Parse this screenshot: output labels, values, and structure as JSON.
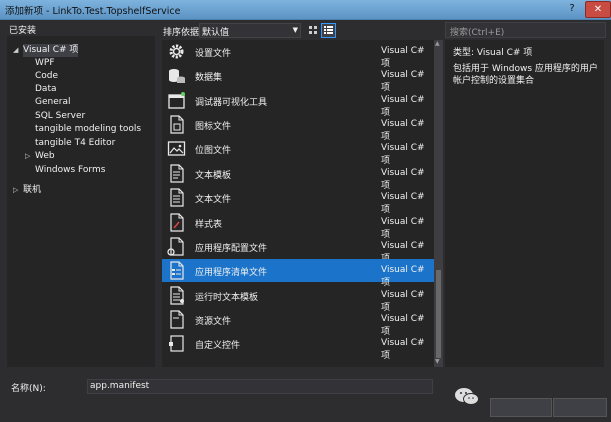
{
  "window": {
    "title": "添加新项 - LinkTo.Test.TopshelfService",
    "help_label": "?",
    "close_label": "✕"
  },
  "left": {
    "installed_label": "已安装",
    "tree": [
      {
        "label": "Visual C# 项",
        "caret": "◢"
      },
      {
        "label": "WPF"
      },
      {
        "label": "Code"
      },
      {
        "label": "Data"
      },
      {
        "label": "General"
      },
      {
        "label": "SQL Server"
      },
      {
        "label": "tangible modeling tools"
      },
      {
        "label": "tangible T4 Editor"
      },
      {
        "label": "Web",
        "caret": "▷"
      },
      {
        "label": "Windows Forms"
      },
      {
        "label": "联机",
        "caret": "▷"
      }
    ]
  },
  "toolbar": {
    "sort_label": "排序依据:",
    "sort_value": "默认值"
  },
  "search": {
    "placeholder": "搜索(Ctrl+E)"
  },
  "items": [
    {
      "name": "设置文件",
      "type": "Visual C# 项",
      "icon": "settings-icon"
    },
    {
      "name": "数据集",
      "type": "Visual C# 项",
      "icon": "dataset-icon"
    },
    {
      "name": "调试器可视化工具",
      "type": "Visual C# 项",
      "icon": "debugger-visualizer-icon"
    },
    {
      "name": "图标文件",
      "type": "Visual C# 项",
      "icon": "icon-file-icon"
    },
    {
      "name": "位图文件",
      "type": "Visual C# 项",
      "icon": "bitmap-icon"
    },
    {
      "name": "文本模板",
      "type": "Visual C# 项",
      "icon": "text-template-icon"
    },
    {
      "name": "文本文件",
      "type": "Visual C# 项",
      "icon": "text-file-icon"
    },
    {
      "name": "样式表",
      "type": "Visual C# 项",
      "icon": "stylesheet-icon"
    },
    {
      "name": "应用程序配置文件",
      "type": "Visual C# 项",
      "icon": "app-config-icon"
    },
    {
      "name": "应用程序清单文件",
      "type": "Visual C# 项",
      "icon": "app-manifest-icon"
    },
    {
      "name": "运行时文本模板",
      "type": "Visual C# 项",
      "icon": "runtime-text-template-icon"
    },
    {
      "name": "资源文件",
      "type": "Visual C# 项",
      "icon": "resource-file-icon"
    },
    {
      "name": "自定义控件",
      "type": "Visual C# 项",
      "icon": "custom-control-icon"
    }
  ],
  "selected_index": 9,
  "details": {
    "type_label": "类型:  Visual C# 项",
    "description": "包括用于 Windows 应用程序的用户帐户控制的设置集合"
  },
  "bottom": {
    "name_label": "名称(N):",
    "name_value": "app.manifest"
  },
  "colors": {
    "accent": "#1b74c9",
    "background": "#2d2d30",
    "panel": "#252526"
  }
}
